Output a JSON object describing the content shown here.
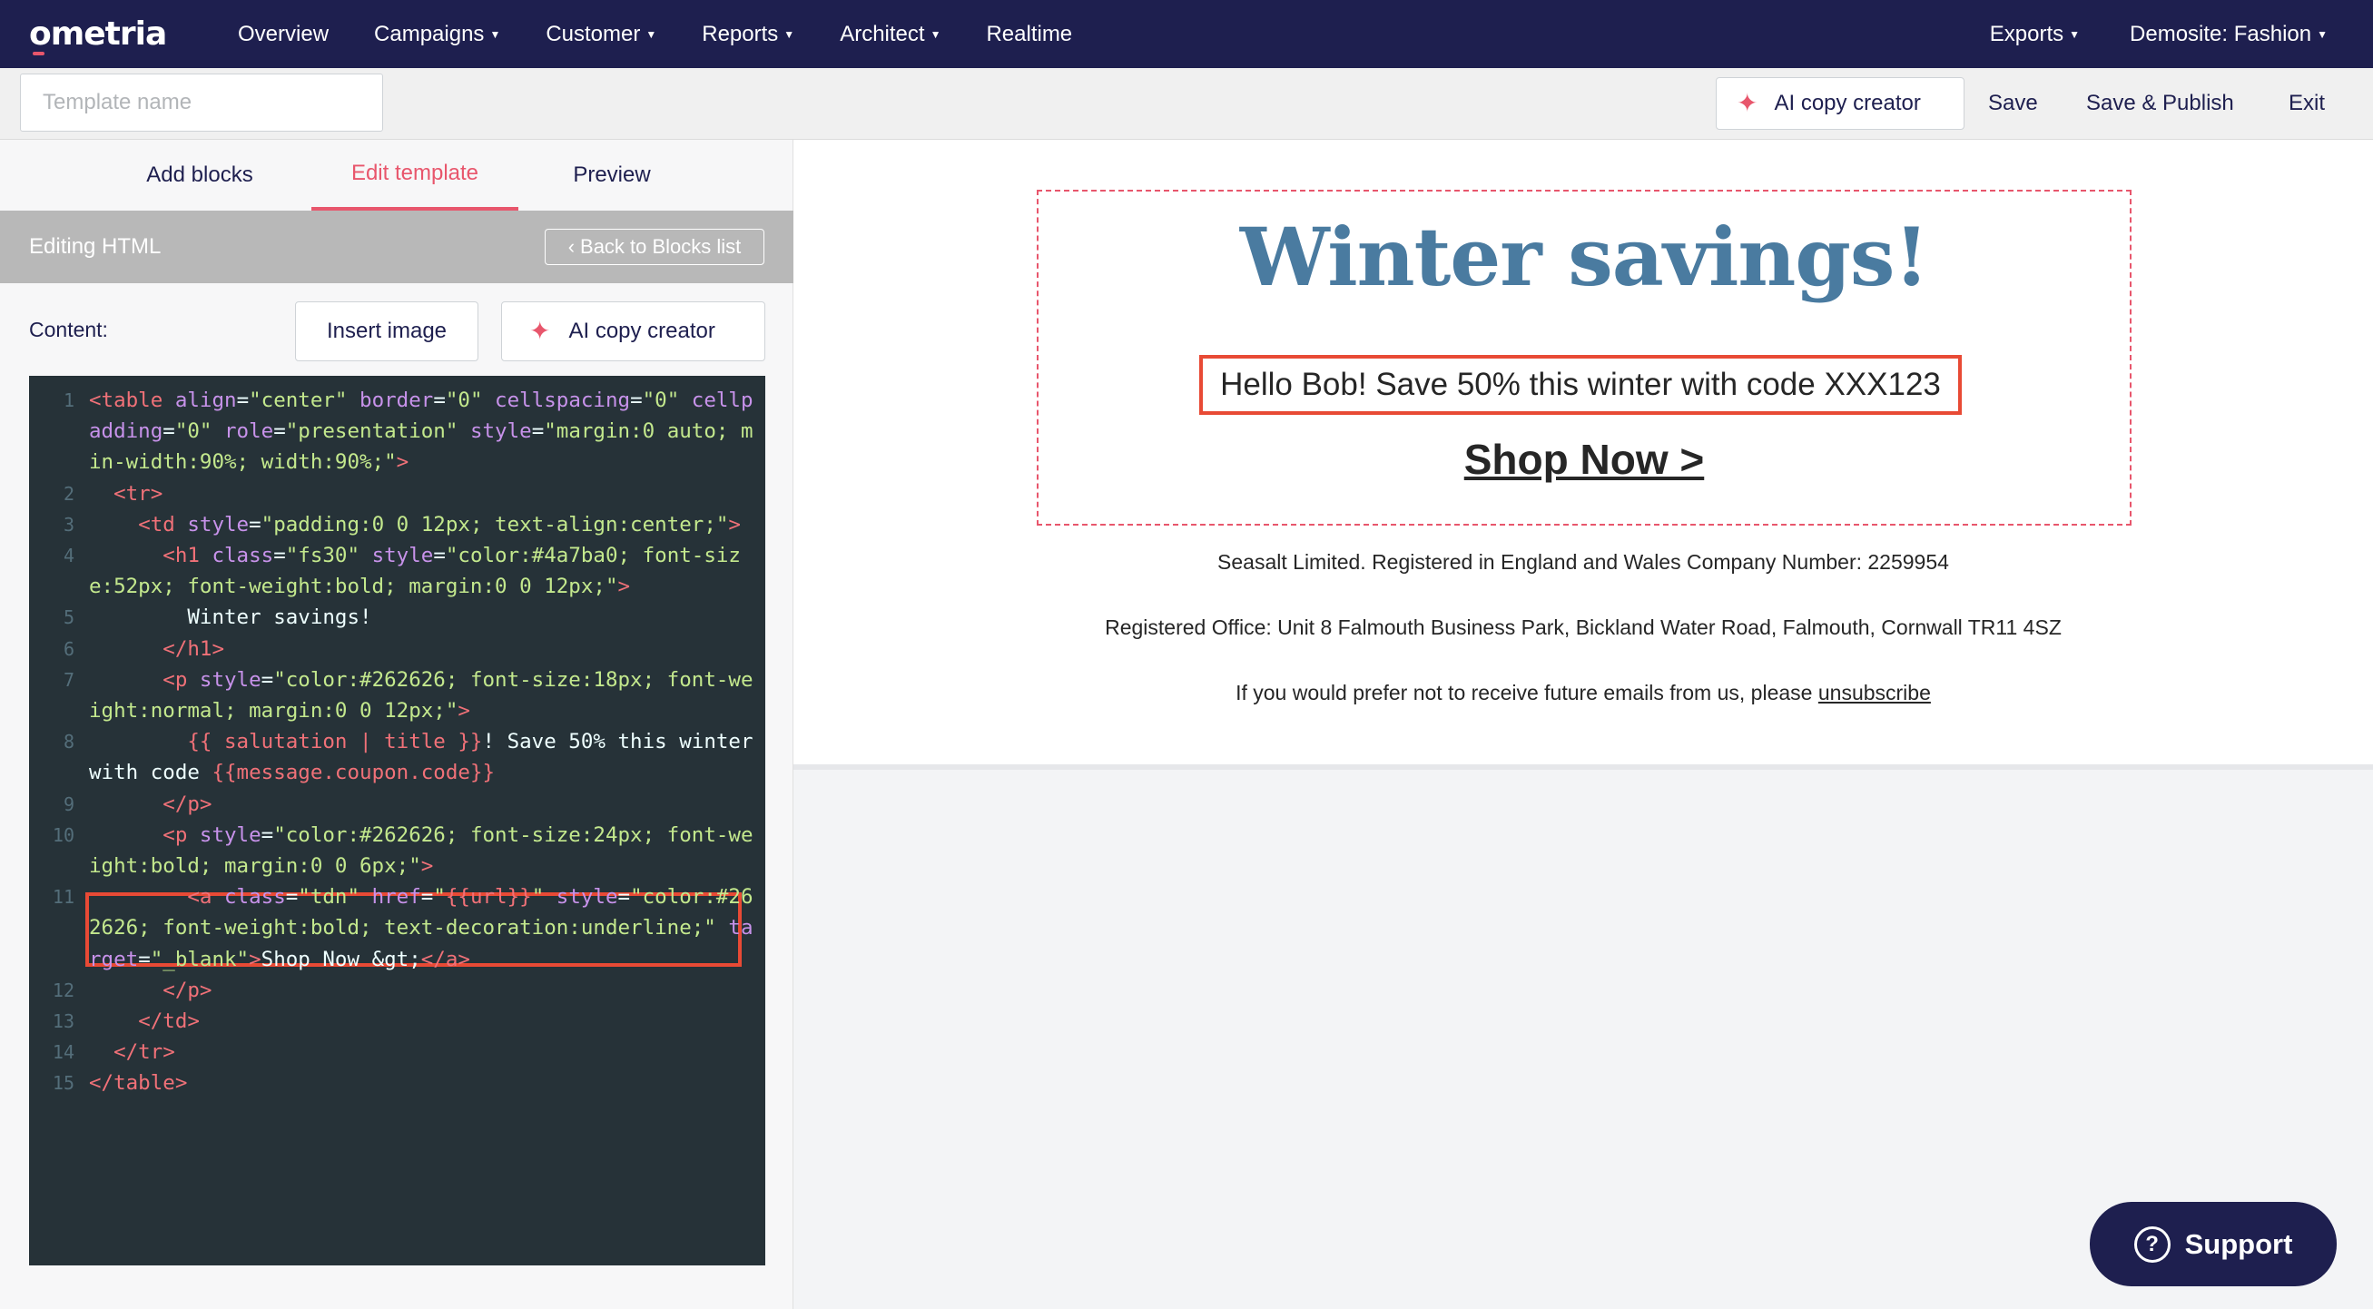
{
  "nav": {
    "logo": "ometria",
    "items": [
      {
        "label": "Overview",
        "caret": false
      },
      {
        "label": "Campaigns",
        "caret": true
      },
      {
        "label": "Customer",
        "caret": true
      },
      {
        "label": "Reports",
        "caret": true
      },
      {
        "label": "Architect",
        "caret": true
      },
      {
        "label": "Realtime",
        "caret": false
      }
    ],
    "right": [
      {
        "label": "Exports",
        "caret": true
      },
      {
        "label": "Demosite: Fashion",
        "caret": true
      }
    ]
  },
  "toolbar": {
    "template_name_placeholder": "Template name",
    "template_name_value": "",
    "ai_copy_label": "AI copy creator",
    "save_label": "Save",
    "save_publish_label": "Save & Publish",
    "exit_label": "Exit"
  },
  "left": {
    "tabs": [
      {
        "label": "Add blocks",
        "active": false
      },
      {
        "label": "Edit template",
        "active": true
      },
      {
        "label": "Preview",
        "active": false
      }
    ],
    "editing_title": "Editing HTML",
    "back_label": "Back to Blocks list",
    "content_label": "Content:",
    "insert_image_label": "Insert image",
    "ai_copy_label": "AI copy creator"
  },
  "code_lines": [
    "<table align=\"center\" border=\"0\" cellspacing=\"0\" cellpadding=\"0\" role=\"presentation\" style=\"margin:0 auto; min-width:90%; width:90%;\">",
    "  <tr>",
    "    <td style=\"padding:0 0 12px; text-align:center;\">",
    "      <h1 class=\"fs30\" style=\"color:#4a7ba0; font-size:52px; font-weight:bold; margin:0 0 12px;\">",
    "        Winter savings!",
    "      </h1>",
    "      <p style=\"color:#262626; font-size:18px; font-weight:normal; margin:0 0 12px;\">",
    "        {{ salutation | title }}! Save 50% this winter with code {{message.coupon.code}}",
    "      </p>",
    "      <p style=\"color:#262626; font-size:24px; font-weight:bold; margin:0 0 6px;\">",
    "        <a class=\"tdn\" href=\"{{url}}\" style=\"color:#262626; font-weight:bold; text-decoration:underline;\" target=\"_blank\">Shop Now &gt;</a>",
    "      </p>",
    "    </td>",
    "  </tr>",
    "</table>"
  ],
  "preview": {
    "heading": "Winter savings!",
    "greeting": "Hello Bob! Save 50% this winter with code XXX123",
    "cta": "Shop Now >",
    "footer1": "Seasalt Limited. Registered in England and Wales Company Number: 2259954",
    "footer2": "Registered Office: Unit 8 Falmouth Business Park, Bickland Water Road, Falmouth, Cornwall TR11 4SZ",
    "footer3_text": "If you would prefer not to receive future emails from us, please ",
    "footer3_link": "unsubscribe"
  },
  "support_label": "Support",
  "colors": {
    "nav_bg": "#1e1f4f",
    "accent": "#e8566c",
    "highlight": "#e84a35",
    "heading_blue": "#4a7ba0",
    "code_bg": "#263238"
  }
}
